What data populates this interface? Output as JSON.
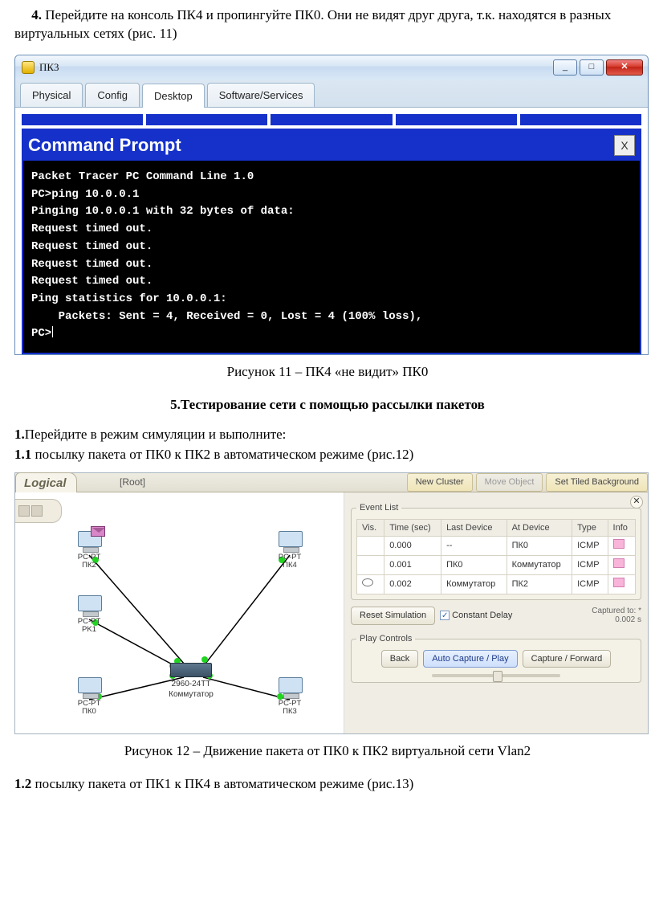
{
  "intro": {
    "num": "4.",
    "text": " Перейдите на консоль ПК4 и пропингуйте ПК0. Они не видят друг друга, т.к. находятся в разных виртуальных сетях (рис. 11)"
  },
  "cmdwin": {
    "title": "ПК3",
    "min": "_",
    "max": "□",
    "close": "✕",
    "tabs": {
      "physical": "Physical",
      "config": "Config",
      "desktop": "Desktop",
      "software": "Software/Services"
    },
    "prompt_title": "Command Prompt",
    "prompt_close": "X",
    "lines": [
      "Packet Tracer PC Command Line 1.0",
      "PC>ping 10.0.0.1",
      "",
      "Pinging 10.0.0.1 with 32 bytes of data:",
      "",
      "Request timed out.",
      "Request timed out.",
      "Request timed out.",
      "Request timed out.",
      "",
      "Ping statistics for 10.0.0.1:",
      "    Packets: Sent = 4, Received = 0, Lost = 4 (100% loss),",
      "",
      "PC>"
    ]
  },
  "caption1": "Рисунок 11 – ПК4 «не видит» ПК0",
  "section5": "5.Тестирование сети с помощью рассылки пакетов",
  "step1": {
    "num": "1.",
    "text": "Перейдите в режим симуляции и выполните:"
  },
  "step11": {
    "num": "1.1",
    "text": " посылку пакета от ПК0 к ПК2 в автоматическом режиме (рис.12)"
  },
  "pt": {
    "logical": "Logical",
    "root": "[Root]",
    "new_cluster": "New Cluster",
    "move_obj": "Move Object",
    "set_bg": "Set Tiled Background",
    "devices": {
      "pk2": {
        "line1": "PC-PT",
        "line2": "ПК2"
      },
      "pk4": {
        "line1": "PC-PT",
        "line2": "ПК4"
      },
      "pk1": {
        "line1": "PC-PT",
        "line2": "PK1"
      },
      "pk0": {
        "line1": "PC-PT",
        "line2": "ПК0"
      },
      "pk3": {
        "line1": "PC-PT",
        "line2": "ПК3"
      },
      "sw": {
        "line1": "2960-24TT",
        "line2": "Коммутатор"
      }
    },
    "panel": {
      "close": "✕",
      "event_list": "Event List",
      "cols": {
        "vis": "Vis.",
        "time": "Time (sec)",
        "last": "Last Device",
        "at": "At Device",
        "type": "Type",
        "info": "Info"
      },
      "rows": [
        {
          "vis": "",
          "time": "0.000",
          "last": "--",
          "at": "ПК0",
          "type": "ICMP"
        },
        {
          "vis": "",
          "time": "0.001",
          "last": "ПК0",
          "at": "Коммутатор",
          "type": "ICMP"
        },
        {
          "vis": "eye",
          "time": "0.002",
          "last": "Коммутатор",
          "at": "ПК2",
          "type": "ICMP"
        }
      ],
      "reset": "Reset Simulation",
      "const_delay": "Constant Delay",
      "captured_lbl": "Captured to:",
      "captured_val": "0.002 s",
      "play_controls": "Play Controls",
      "back": "Back",
      "auto": "Auto Capture / Play",
      "fwd": "Capture / Forward"
    }
  },
  "caption2": "Рисунок 12 – Движение пакета от ПК0 к ПК2 виртуальной сети Vlan2",
  "step12": {
    "num": "1.2",
    "text": " посылку пакета от ПК1 к ПК4 в автоматическом режиме (рис.13)"
  }
}
